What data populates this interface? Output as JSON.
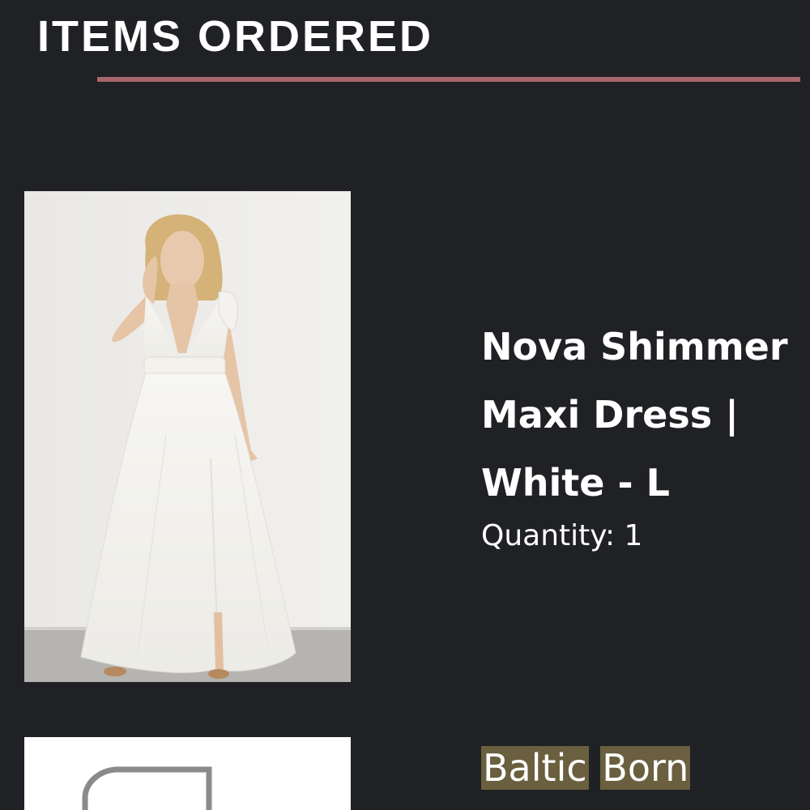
{
  "section": {
    "title": "ITEMS ORDERED"
  },
  "colors": {
    "background": "#1f2125",
    "divider": "#a8676b",
    "brand_highlight": "#6a5f3e"
  },
  "items": [
    {
      "name_lines": [
        "Nova Shimmer",
        "Maxi Dress |",
        "White - L"
      ],
      "quantity": "Quantity: 1",
      "image": "product-photo-white-maxi-dress"
    },
    {
      "brand_words": [
        "Baltic",
        "Born"
      ],
      "image": "product-image-partial"
    }
  ]
}
